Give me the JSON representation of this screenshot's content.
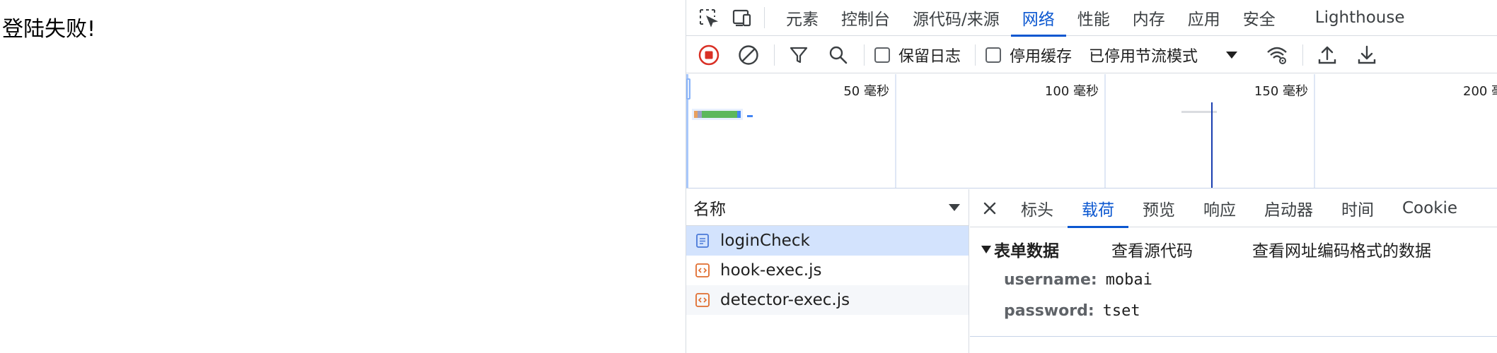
{
  "page": {
    "message": "登陆失败!"
  },
  "devtools": {
    "main_tabs": [
      {
        "label": "元素"
      },
      {
        "label": "控制台"
      },
      {
        "label": "源代码/来源"
      },
      {
        "label": "网络",
        "active": true
      },
      {
        "label": "性能"
      },
      {
        "label": "内存"
      },
      {
        "label": "应用"
      },
      {
        "label": "安全"
      },
      {
        "label": "Lighthouse"
      }
    ],
    "toolbar": {
      "preserve_log_label": "保留日志",
      "disable_cache_label": "停用缓存",
      "throttling_label": "已停用节流模式",
      "record_color": "#d93025"
    },
    "overview": {
      "ticks": [
        "50 毫秒",
        "100 毫秒",
        "150 毫秒",
        "200 毫秒"
      ]
    },
    "requests": {
      "header_label": "名称",
      "items": [
        {
          "name": "loginCheck",
          "type": "document-icon",
          "selected": true
        },
        {
          "name": "hook-exec.js",
          "type": "script-icon"
        },
        {
          "name": "detector-exec.js",
          "type": "script-icon"
        }
      ]
    },
    "detail": {
      "tabs": [
        {
          "label": "标头"
        },
        {
          "label": "载荷",
          "active": true
        },
        {
          "label": "预览"
        },
        {
          "label": "响应"
        },
        {
          "label": "启动器"
        },
        {
          "label": "时间"
        },
        {
          "label": "Cookie"
        }
      ],
      "form": {
        "title": "表单数据",
        "view_source": "查看源代码",
        "view_url_encoded": "查看网址编码格式的数据",
        "fields": [
          {
            "key": "username:",
            "value": "mobai"
          },
          {
            "key": "password:",
            "value": "tset"
          }
        ]
      }
    },
    "accent_color": "#0b57d0"
  }
}
